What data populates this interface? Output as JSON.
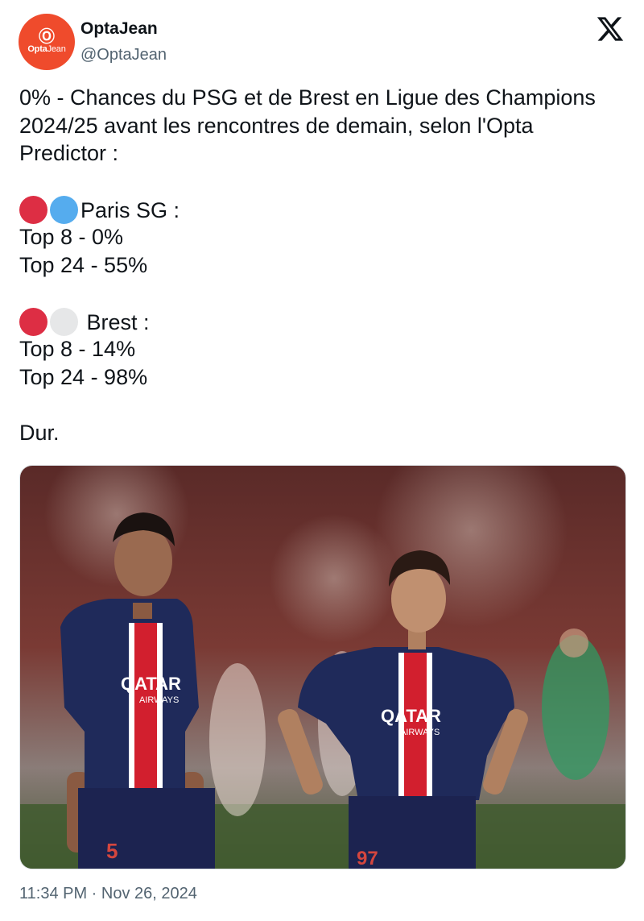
{
  "author": {
    "name": "OptaJean",
    "handle": "@OptaJean",
    "avatar_mark": "Ⓞ",
    "avatar_brand_bold": "Opta",
    "avatar_brand_thin": "Jean",
    "avatar_color": "#ef4b2c"
  },
  "platform_icon": "x-logo-icon",
  "tweet": {
    "line1": "0% - Chances du PSG et de Brest en Ligue des Champions",
    "line2": "2024/25 avant les rencontres de demain, selon l'Opta",
    "line3": "Predictor :",
    "psg_team": "Paris SG :",
    "psg_top8": "Top 8 - 0%",
    "psg_top24": "Top 24 - 55%",
    "brest_team": " Brest :",
    "brest_top8": "Top 8 - 14%",
    "brest_top24": "Top 24 - 98%",
    "closing": "Dur.",
    "psg_emoji_colors": [
      "#dd2e44",
      "#55acee"
    ],
    "brest_emoji_colors": [
      "#dd2e44",
      "#e6e7e8"
    ]
  },
  "media": {
    "player_left_number": "5",
    "player_right_number": "97",
    "sponsor": "QATAR",
    "sponsor_sub": "AIRWAYS"
  },
  "timestamp": "11:34 PM · Nov 26, 2024"
}
